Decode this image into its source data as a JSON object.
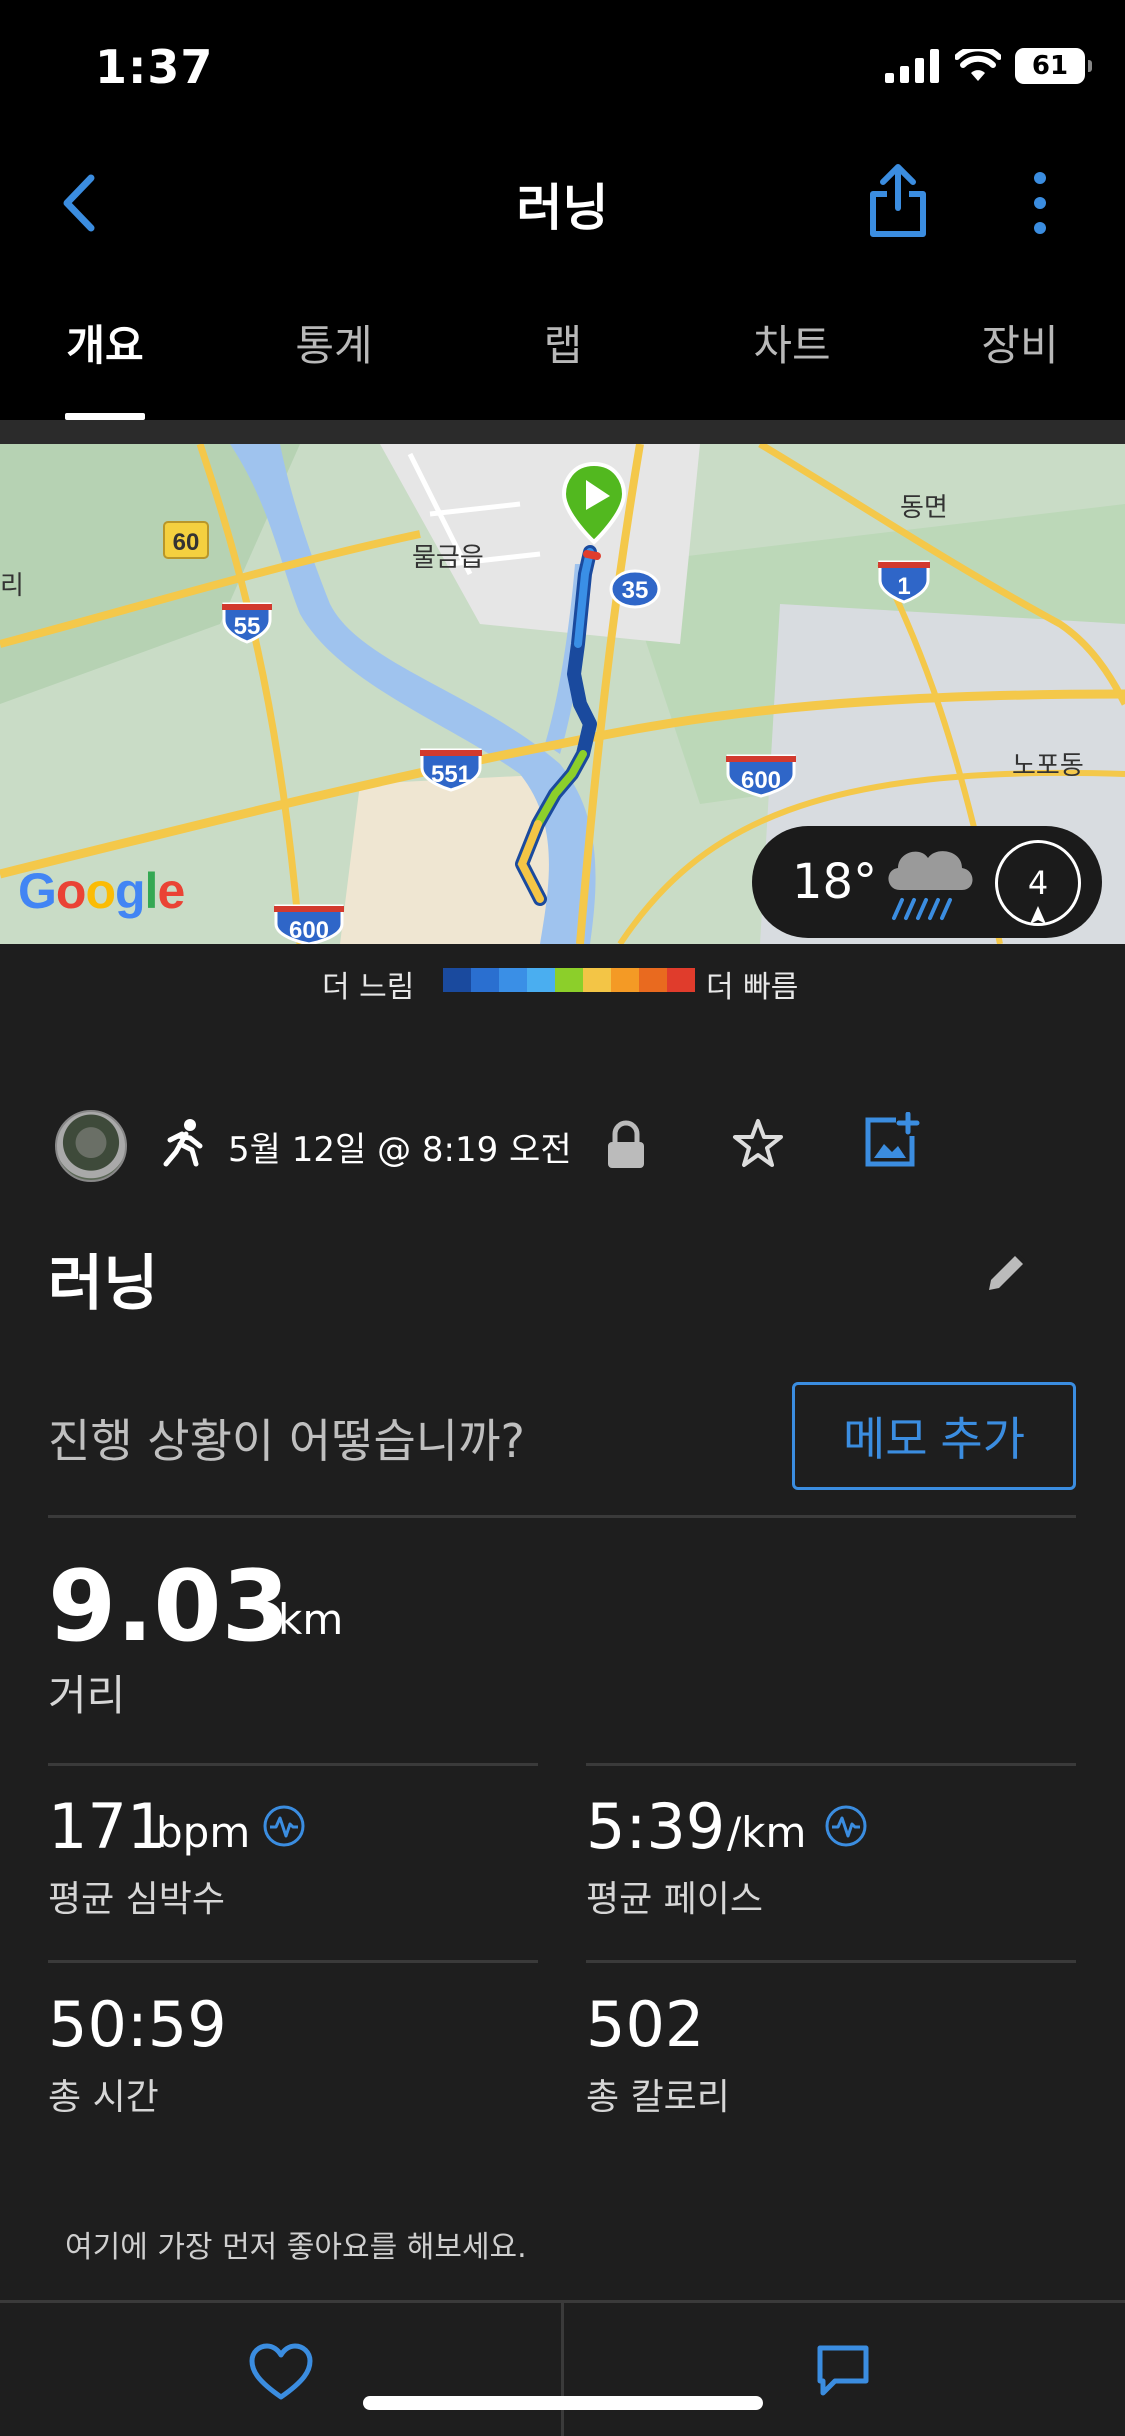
{
  "status_bar": {
    "time": "1:37",
    "battery": "61"
  },
  "nav": {
    "title": "러닝"
  },
  "tabs": [
    {
      "label": "개요",
      "active": true
    },
    {
      "label": "통계",
      "active": false
    },
    {
      "label": "랩",
      "active": false
    },
    {
      "label": "차트",
      "active": false
    },
    {
      "label": "장비",
      "active": false
    }
  ],
  "map": {
    "labels": {
      "town_left": "물금읍",
      "town_right": "동면",
      "town_far_right": "노포동",
      "edge_left": "리",
      "hwy_60": "60",
      "hwy_55": "55",
      "hwy_35": "35",
      "hwy_1": "1",
      "hwy_551": "551",
      "hwy_600_right": "600",
      "hwy_600_bottom": "600"
    },
    "google_logo": "Google",
    "weather": {
      "temp": "18°",
      "icon": "rain-cloud-icon",
      "wind": "4"
    }
  },
  "legend": {
    "slow": "더 느림",
    "fast": "더 빠름",
    "colors": [
      "#1a4a9e",
      "#2a6fd0",
      "#3a8fe6",
      "#4aaef0",
      "#8ccf2a",
      "#f3c546",
      "#f49a25",
      "#e96a1f",
      "#e03c2c"
    ]
  },
  "activity": {
    "date": "5월 12일 @ 8:19 오전",
    "title": "러닝",
    "progress_question": "진행 상황이 어떻습니까?",
    "memo_button": "메모 추가"
  },
  "stats": {
    "distance": {
      "value": "9.03",
      "unit": "km",
      "label": "거리"
    },
    "heart_rate": {
      "value": "171",
      "unit": "bpm",
      "label": "평균 심박수"
    },
    "pace": {
      "value": "5:39",
      "unit": "/km",
      "label": "평균 페이스"
    },
    "time": {
      "value": "50:59",
      "label": "총 시간"
    },
    "calories": {
      "value": "502",
      "label": "총 칼로리"
    }
  },
  "social": {
    "like_prompt": "여기에 가장 먼저 좋아요를 해보세요."
  },
  "colors": {
    "accent": "#3b8de0",
    "background": "#1e1e1e",
    "bar": "#000000"
  }
}
